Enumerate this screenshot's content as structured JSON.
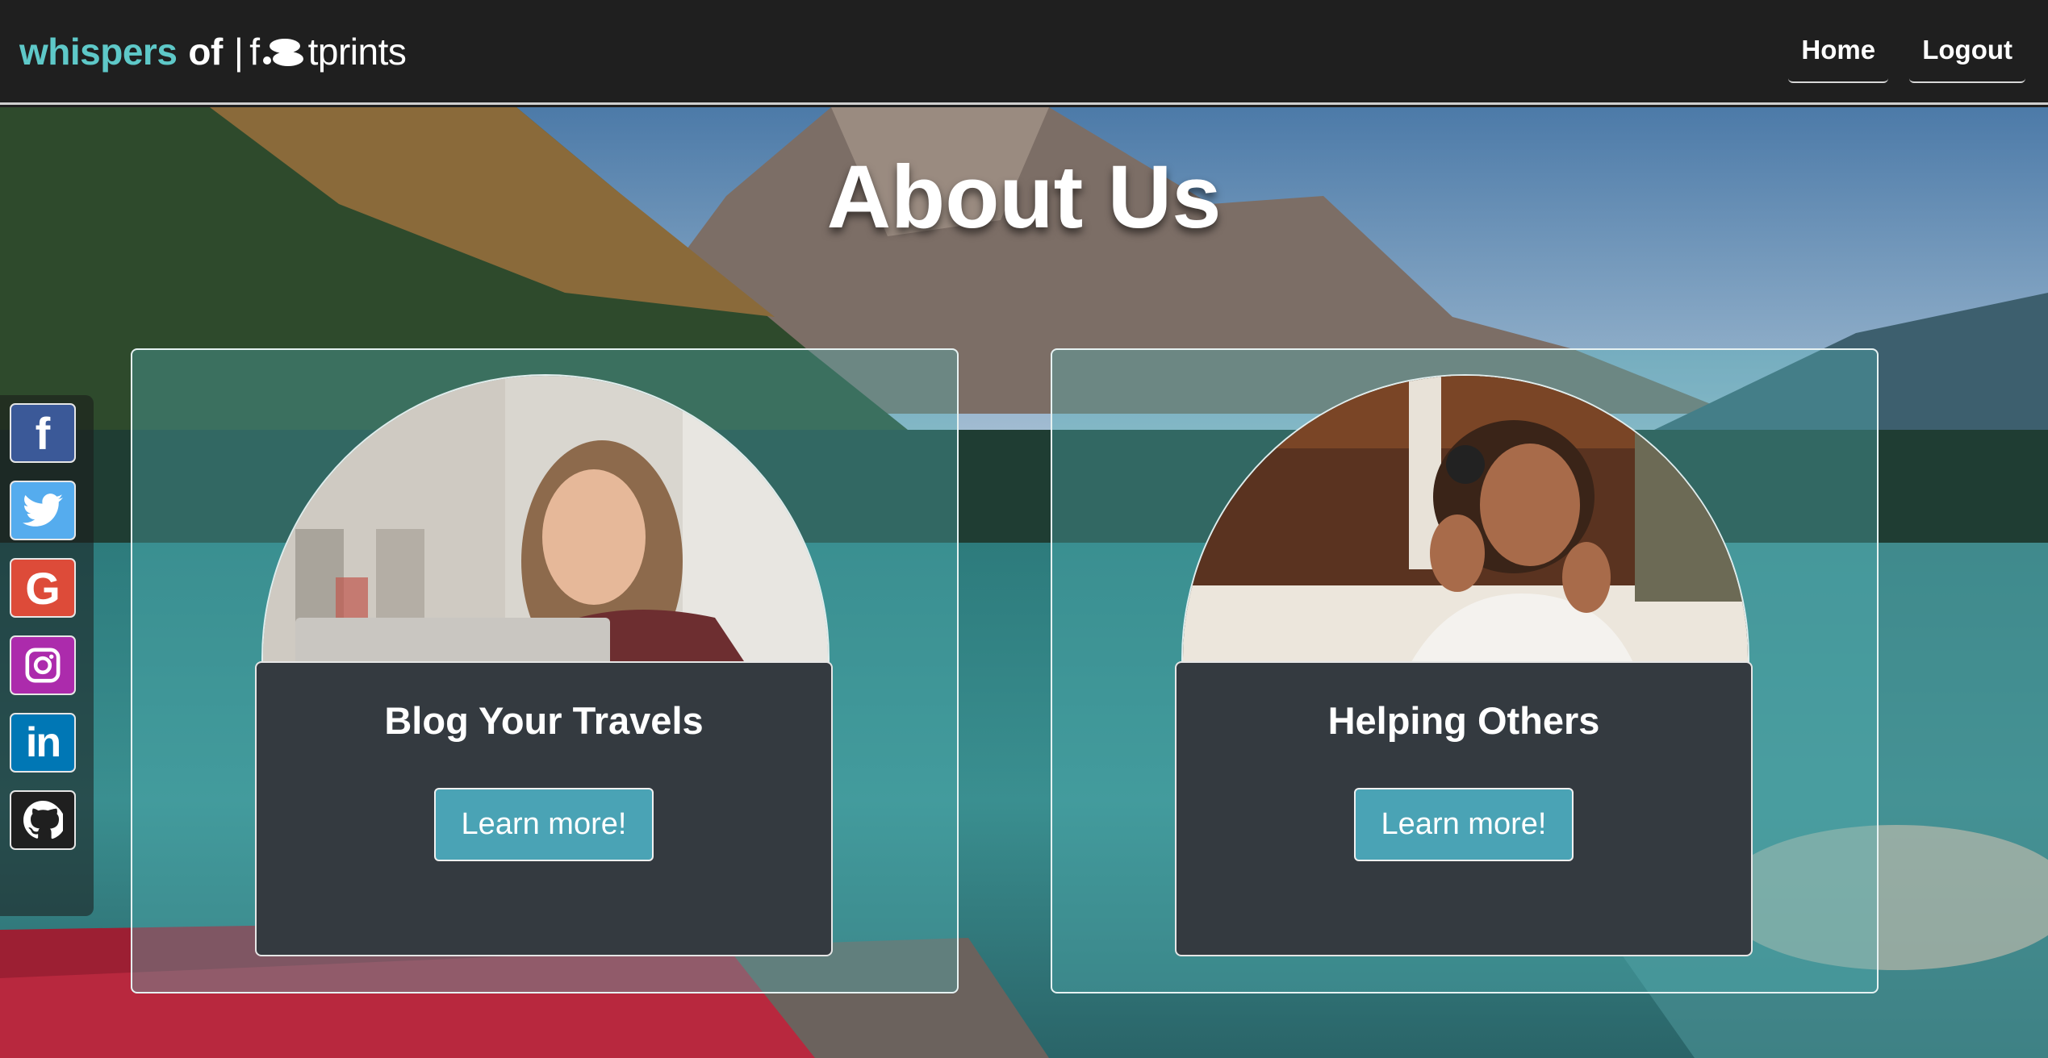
{
  "navbar": {
    "brand": {
      "word1": "whispers",
      "word2": "of",
      "separator": "|",
      "part_f": "f",
      "part_tprints": "tprints"
    },
    "links": [
      {
        "label": "Home"
      },
      {
        "label": "Logout"
      }
    ]
  },
  "hero": {
    "title": "About Us"
  },
  "social": [
    {
      "icon": "facebook-icon",
      "color": "#3b5998"
    },
    {
      "icon": "twitter-icon",
      "color": "#55acee"
    },
    {
      "icon": "google-icon",
      "color": "#dd4b39"
    },
    {
      "icon": "instagram-icon",
      "color": "#ac2bac"
    },
    {
      "icon": "linkedin-icon",
      "color": "#0077b5"
    },
    {
      "icon": "github-icon",
      "color": "#1f1f1f"
    }
  ],
  "cards": [
    {
      "heading": "Blog Your Travels",
      "button": "Learn more!"
    },
    {
      "heading": "Helping Others",
      "button": "Learn more!"
    }
  ],
  "colors": {
    "brand_accent": "#5ec8c8",
    "button": "#4aa3b5",
    "panel": "#343a40",
    "navbar": "#1f1f1f"
  }
}
